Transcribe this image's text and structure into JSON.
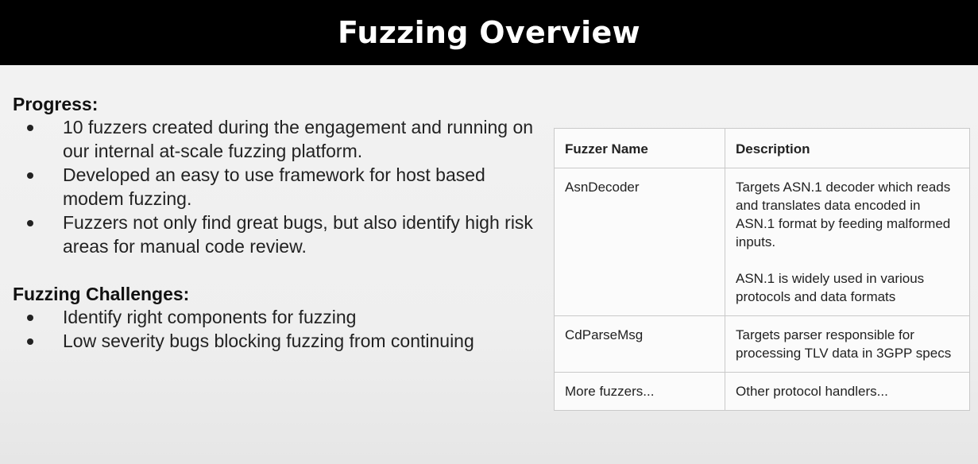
{
  "slide": {
    "title": "Fuzzing Overview"
  },
  "progress": {
    "heading": "Progress:",
    "items": [
      "10 fuzzers created during the engagement and running on our internal at-scale fuzzing platform.",
      "Developed an easy to use framework for host based modem fuzzing.",
      "Fuzzers not only find great bugs, but also identify high risk areas for manual code review."
    ]
  },
  "challenges": {
    "heading": "Fuzzing Challenges:",
    "items": [
      "Identify right components for fuzzing",
      "Low severity bugs blocking fuzzing from continuing"
    ]
  },
  "table": {
    "headers": [
      "Fuzzer Name",
      "Description"
    ],
    "rows": [
      {
        "name": "AsnDecoder",
        "description": [
          "Targets ASN.1 decoder which reads and translates data encoded in ASN.1 format by feeding malformed inputs.",
          "ASN.1 is widely used in various protocols and data formats"
        ]
      },
      {
        "name": "CdParseMsg",
        "description": [
          "Targets parser responsible for processing TLV data in 3GPP specs"
        ]
      },
      {
        "name": "More fuzzers...",
        "description": [
          "Other protocol handlers..."
        ]
      }
    ]
  }
}
